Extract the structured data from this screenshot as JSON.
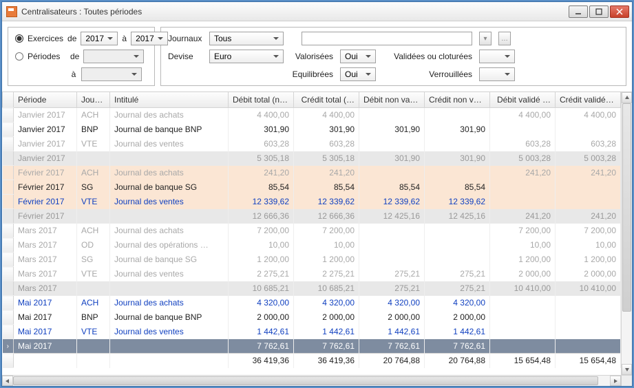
{
  "window": {
    "title": "Centralisateurs : Toutes périodes"
  },
  "filters": {
    "exercices_label": "Exercices",
    "periodes_label": "Périodes",
    "de_label": "de",
    "a_label": "à",
    "year_from": "2017",
    "year_to": "2017",
    "journaux_label": "Journaux",
    "journaux_value": "Tous",
    "devise_label": "Devise",
    "devise_value": "Euro",
    "valorisees_label": "Valorisées",
    "equilibrees_label": "Equilibrées",
    "validees_label": "Validées ou cloturées",
    "verrouillees_label": "Verrouillées",
    "oui": "Oui"
  },
  "columns": {
    "periode": "Période",
    "jour": "Jour…",
    "intitule": "Intitulé",
    "debit_total": "Débit total (non vali…",
    "credit_total": "Crédit total (…",
    "debit_nv": "Débit non validé …",
    "credit_nv": "Crédit non validé …",
    "debit_v": "Débit validé …",
    "credit_v": "Crédit validé …"
  },
  "rows": [
    {
      "style": "gray",
      "periode": "Janvier 2017",
      "jour": "ACH",
      "intitule": "Journal des achats",
      "dt": "4 400,00",
      "ct": "4 400,00",
      "dnv": "",
      "cnv": "",
      "dv": "4 400,00",
      "cv": "4 400,00"
    },
    {
      "style": "black",
      "periode": "Janvier 2017",
      "jour": "BNP",
      "intitule": "Journal de banque BNP",
      "dt": "301,90",
      "ct": "301,90",
      "dnv": "301,90",
      "cnv": "301,90",
      "dv": "",
      "cv": ""
    },
    {
      "style": "gray",
      "periode": "Janvier 2017",
      "jour": "VTE",
      "intitule": "Journal des ventes",
      "dt": "603,28",
      "ct": "603,28",
      "dnv": "",
      "cnv": "",
      "dv": "603,28",
      "cv": "603,28"
    },
    {
      "style": "subtotal",
      "periode": "Janvier 2017",
      "jour": "",
      "intitule": "",
      "dt": "5 305,18",
      "ct": "5 305,18",
      "dnv": "301,90",
      "cnv": "301,90",
      "dv": "5 003,28",
      "cv": "5 003,28"
    },
    {
      "style": "peach gray",
      "periode": "Février 2017",
      "jour": "ACH",
      "intitule": "Journal des achats",
      "dt": "241,20",
      "ct": "241,20",
      "dnv": "",
      "cnv": "",
      "dv": "241,20",
      "cv": "241,20"
    },
    {
      "style": "peach black",
      "periode": "Février 2017",
      "jour": "SG",
      "intitule": "Journal de banque SG",
      "dt": "85,54",
      "ct": "85,54",
      "dnv": "85,54",
      "cnv": "85,54",
      "dv": "",
      "cv": ""
    },
    {
      "style": "bluep",
      "periode": "Février 2017",
      "jour": "VTE",
      "intitule": "Journal des ventes",
      "dt": "12 339,62",
      "ct": "12 339,62",
      "dnv": "12 339,62",
      "cnv": "12 339,62",
      "dv": "",
      "cv": ""
    },
    {
      "style": "subtotal",
      "periode": "Février 2017",
      "jour": "",
      "intitule": "",
      "dt": "12 666,36",
      "ct": "12 666,36",
      "dnv": "12 425,16",
      "cnv": "12 425,16",
      "dv": "241,20",
      "cv": "241,20"
    },
    {
      "style": "gray",
      "periode": "Mars 2017",
      "jour": "ACH",
      "intitule": "Journal des achats",
      "dt": "7 200,00",
      "ct": "7 200,00",
      "dnv": "",
      "cnv": "",
      "dv": "7 200,00",
      "cv": "7 200,00"
    },
    {
      "style": "gray",
      "periode": "Mars 2017",
      "jour": "OD",
      "intitule": "Journal des opérations …",
      "dt": "10,00",
      "ct": "10,00",
      "dnv": "",
      "cnv": "",
      "dv": "10,00",
      "cv": "10,00"
    },
    {
      "style": "gray",
      "periode": "Mars 2017",
      "jour": "SG",
      "intitule": "Journal de banque SG",
      "dt": "1 200,00",
      "ct": "1 200,00",
      "dnv": "",
      "cnv": "",
      "dv": "1 200,00",
      "cv": "1 200,00"
    },
    {
      "style": "gray",
      "periode": "Mars 2017",
      "jour": "VTE",
      "intitule": "Journal des ventes",
      "dt": "2 275,21",
      "ct": "2 275,21",
      "dnv": "275,21",
      "cnv": "275,21",
      "dv": "2 000,00",
      "cv": "2 000,00"
    },
    {
      "style": "subtotal",
      "periode": "Mars 2017",
      "jour": "",
      "intitule": "",
      "dt": "10 685,21",
      "ct": "10 685,21",
      "dnv": "275,21",
      "cnv": "275,21",
      "dv": "10 410,00",
      "cv": "10 410,00"
    },
    {
      "style": "blue",
      "periode": "Mai 2017",
      "jour": "ACH",
      "intitule": "Journal des achats",
      "dt": "4 320,00",
      "ct": "4 320,00",
      "dnv": "4 320,00",
      "cnv": "4 320,00",
      "dv": "",
      "cv": ""
    },
    {
      "style": "black",
      "periode": "Mai 2017",
      "jour": "BNP",
      "intitule": "Journal de banque BNP",
      "dt": "2 000,00",
      "ct": "2 000,00",
      "dnv": "2 000,00",
      "cnv": "2 000,00",
      "dv": "",
      "cv": ""
    },
    {
      "style": "blue",
      "periode": "Mai 2017",
      "jour": "VTE",
      "intitule": "Journal des ventes",
      "dt": "1 442,61",
      "ct": "1 442,61",
      "dnv": "1 442,61",
      "cnv": "1 442,61",
      "dv": "",
      "cv": ""
    },
    {
      "style": "sel",
      "periode": "Mai 2017",
      "jour": "",
      "intitule": "",
      "dt": "7 762,61",
      "ct": "7 762,61",
      "dnv": "7 762,61",
      "cnv": "7 762,61",
      "dv": "",
      "cv": "",
      "handle": "›"
    }
  ],
  "totals": {
    "dt": "36 419,36",
    "ct": "36 419,36",
    "dnv": "20 764,88",
    "cnv": "20 764,88",
    "dv": "15 654,48",
    "cv": "15 654,48"
  }
}
